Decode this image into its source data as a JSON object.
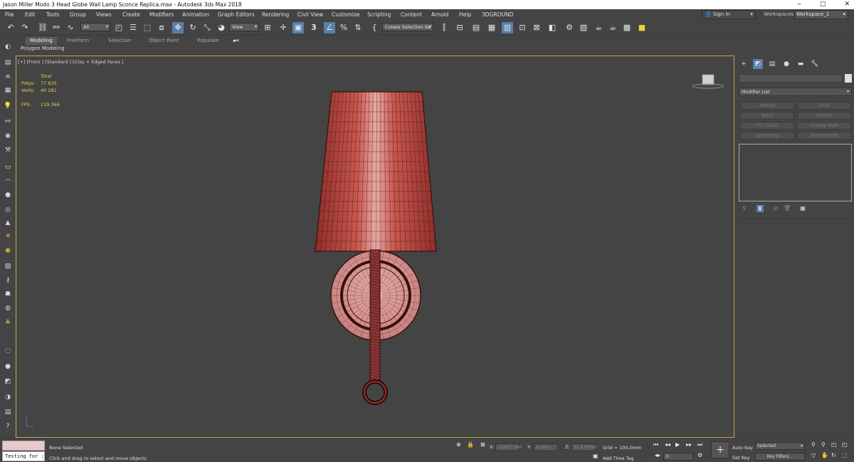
{
  "window": {
    "title": "Jason Miller Modo 3 Head Globe Wall Lamp Sconce Replica.max - Autodesk 3ds Max 2018",
    "minimize": "‒",
    "maximize": "▢",
    "close": "✕"
  },
  "menu": [
    "File",
    "Edit",
    "Tools",
    "Group",
    "Views",
    "Create",
    "Modifiers",
    "Animation",
    "Graph Editors",
    "Rendering",
    "Civil View",
    "Customize",
    "Scripting",
    "Content",
    "Arnold",
    "Help",
    "3DGROUND"
  ],
  "account": {
    "sign_in": "Sign In",
    "workspaces_label": "Workspaces:",
    "workspace": "Workspace_1"
  },
  "toolbar": {
    "filter": "All",
    "ref_coord": "View",
    "selection_set": "Create Selection Se",
    "snap_label": "3"
  },
  "ribbon": {
    "tabs": [
      "Modeling",
      "Freeform",
      "Selection",
      "Object Paint",
      "Populate"
    ],
    "active": "Modeling",
    "subtitle": "Polygon Modeling"
  },
  "viewport": {
    "label": "[+] [Front ] [Standard ] [Clay + Edged Faces ]",
    "stats": {
      "total_label": "Total",
      "polys_label": "Polys:",
      "polys": "77 635",
      "verts_label": "Verts:",
      "verts": "40 281",
      "fps_label": "FPS:",
      "fps": "219.366"
    },
    "model_colors": {
      "shade": "#b84a44",
      "highlight": "#e8a8a8",
      "wire": "#3a0e0e",
      "stem": "#8a3535"
    }
  },
  "command_panel": {
    "modifier_list": "Modifier List",
    "buttons": [
      "Normal",
      "Shell",
      "Bend",
      "Smooth",
      "FFD 2x2x2",
      "Unwrap UVW",
      "Symmetry",
      "TurboSmooth"
    ]
  },
  "status": {
    "selection": "None Selected",
    "prompt": "Click and drag to select and move objects",
    "script_input": "Testing for :",
    "x_label": "X:",
    "x": "-23857,086",
    "y_label": "Y:",
    "y": "0,0mm",
    "z_label": "Z:",
    "z": "21,670mm",
    "grid": "Grid = 100,0mm",
    "add_time_tag": "Add Time Tag",
    "auto_key": "Auto Key",
    "set_key": "Set Key",
    "selected": "Selected",
    "key_filters": "Key Filters...",
    "frame": "0"
  }
}
